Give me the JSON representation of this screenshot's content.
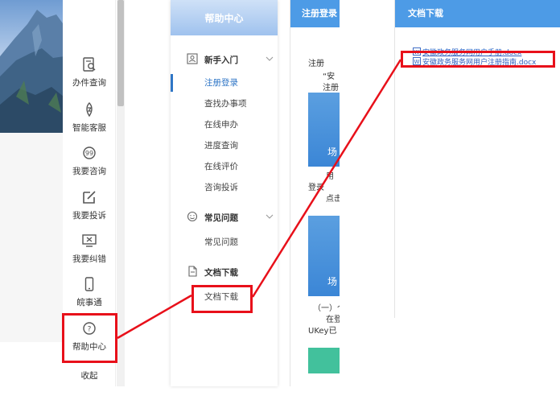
{
  "service_bar": {
    "items": [
      {
        "label": "办件查询",
        "icon": "search-doc-icon"
      },
      {
        "label": "智能客服",
        "icon": "robot-icon"
      },
      {
        "label": "我要咨询",
        "icon": "chat-icon"
      },
      {
        "label": "我要投诉",
        "icon": "edit-icon"
      },
      {
        "label": "我要纠错",
        "icon": "monitor-x-icon"
      },
      {
        "label": "皖事通",
        "icon": "phone-icon"
      },
      {
        "label": "帮助中心",
        "icon": "help-icon"
      },
      {
        "label": "收起",
        "icon": ""
      }
    ]
  },
  "help_center": {
    "title": "帮助中心",
    "groups": [
      {
        "label": "新手入门",
        "icon": "person-card-icon",
        "items": [
          "注册登录",
          "查找办事项",
          "在线申办",
          "进度查询",
          "在线评价",
          "咨询投诉"
        ]
      },
      {
        "label": "常见问题",
        "icon": "smile-icon",
        "items": [
          "常见问题"
        ]
      },
      {
        "label": "文档下载",
        "icon": "document-icon",
        "items": [
          "文档下载"
        ]
      }
    ],
    "active_item": "注册登录"
  },
  "registration": {
    "title": "注册登录",
    "text_1": "注册",
    "text_2": "“安",
    "text_3": "注册",
    "block_1_label": "场",
    "text_4": "用",
    "text_5": "登录",
    "text_6": "点击",
    "block_2_label": "场",
    "text_7": "（一）个",
    "text_8": "在登",
    "text_9": "UKey已"
  },
  "documents": {
    "title": "文档下载",
    "files": [
      "安徽政务服务网用户手册.docx",
      "安徽政务服务网用户注册指南.docx"
    ]
  },
  "colors": {
    "accent": "#4d9be6",
    "highlight": "#e8101a",
    "link": "#2f5fbf"
  }
}
